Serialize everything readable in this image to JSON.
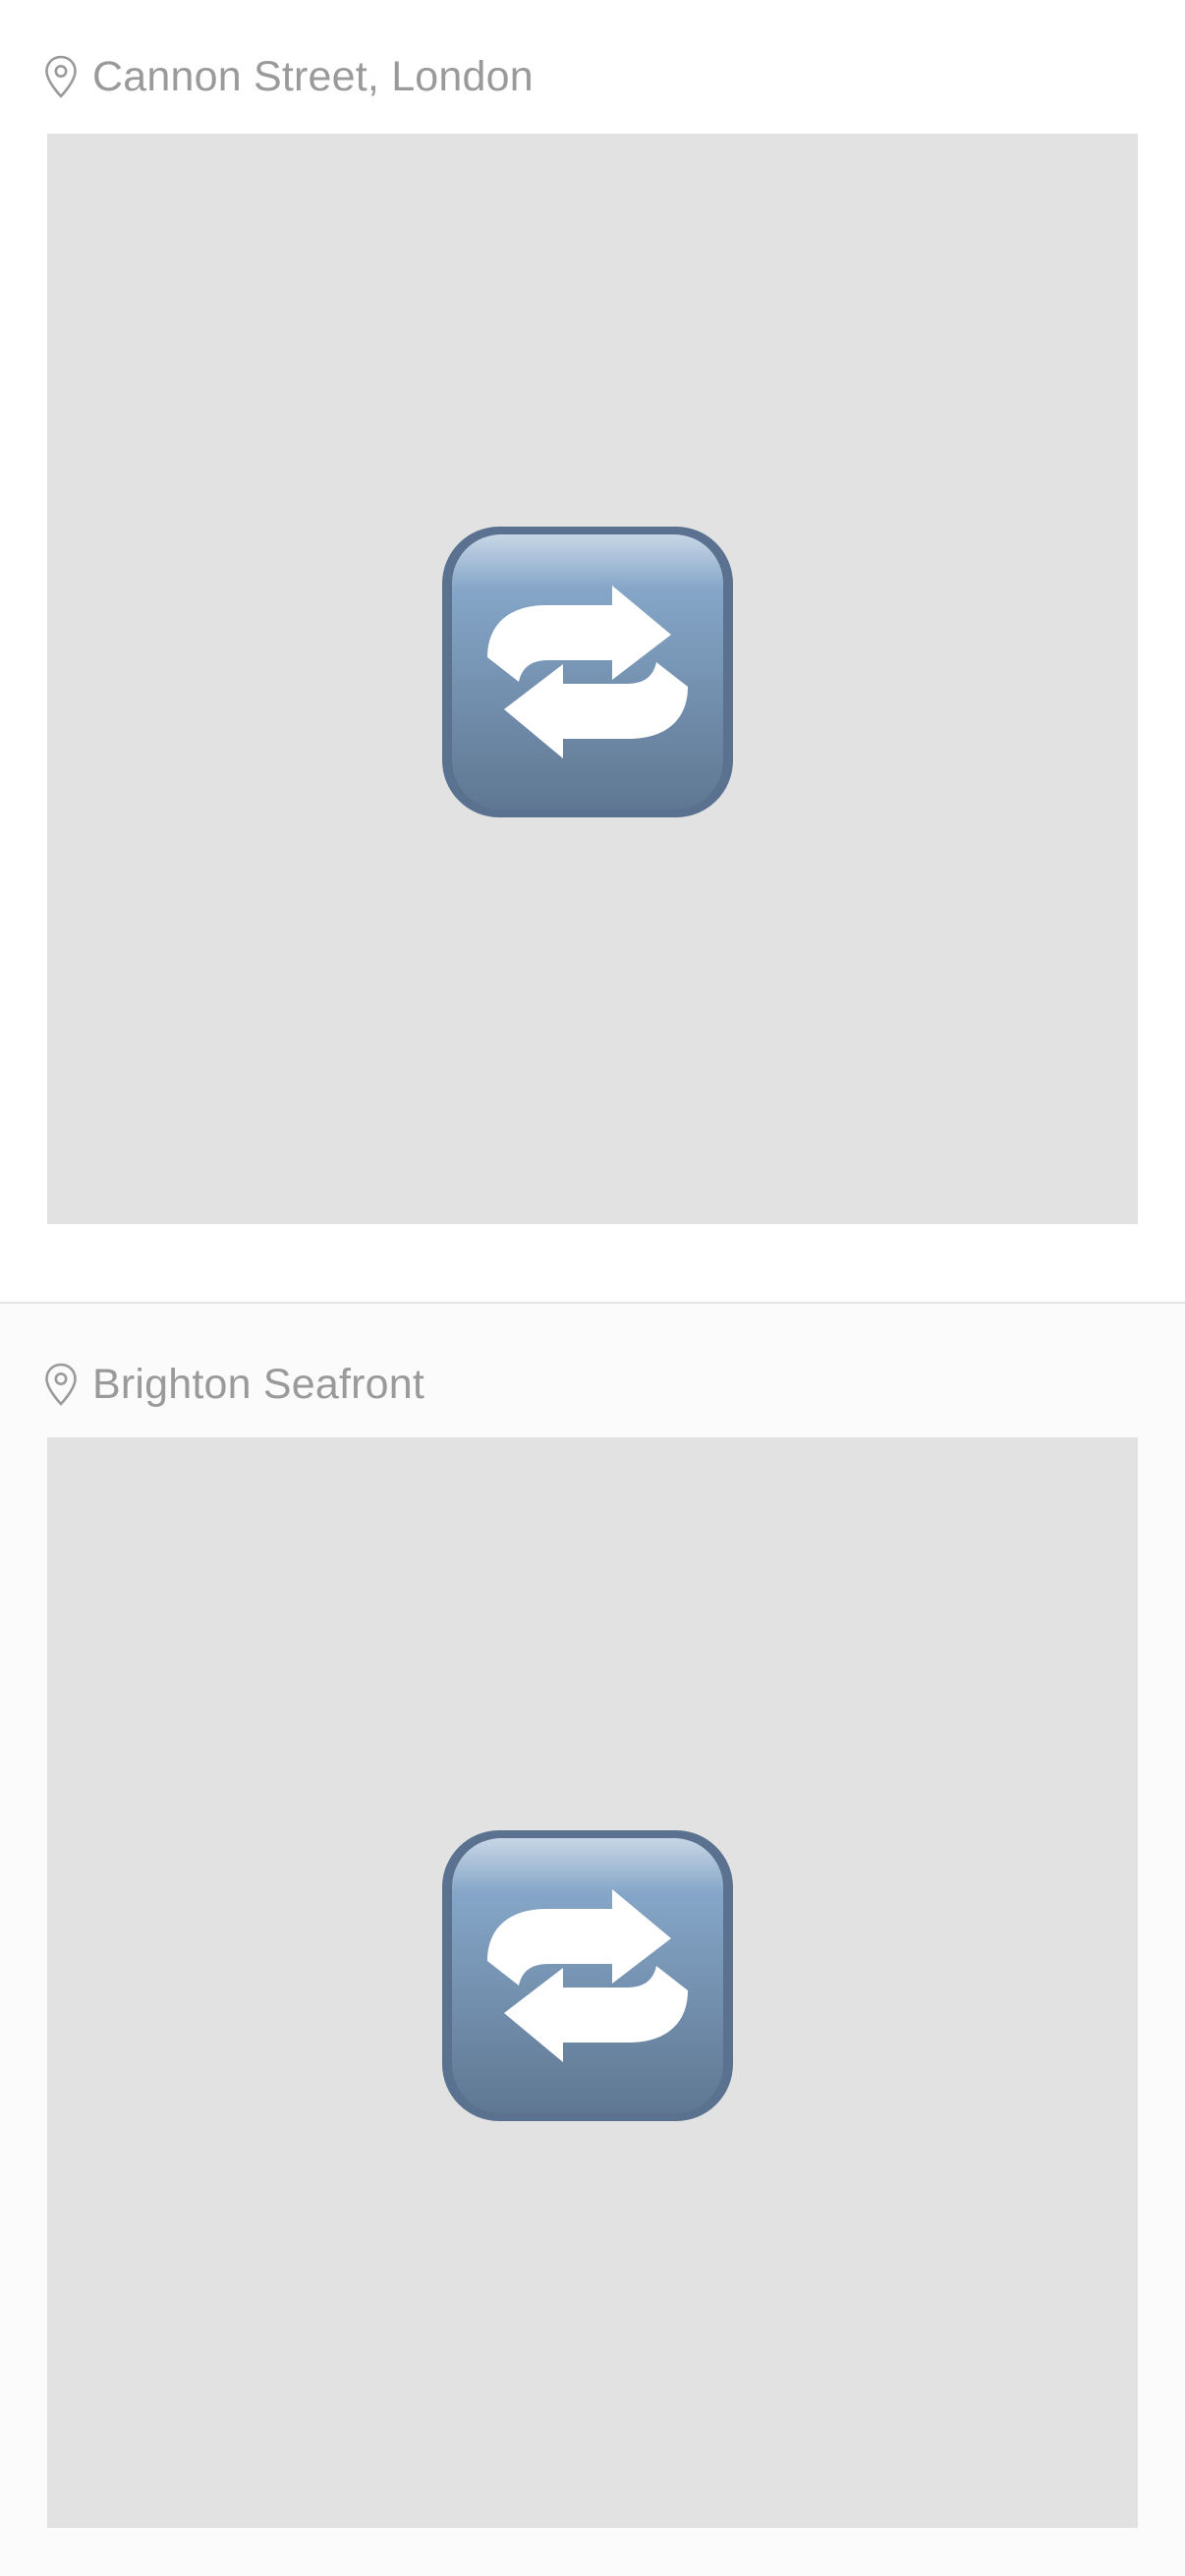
{
  "posts": [
    {
      "location": "Cannon Street, London",
      "location_icon": "location-pin-icon",
      "media_placeholder_icon": "repeat-button-icon"
    },
    {
      "location": "Brighton Seafront",
      "location_icon": "location-pin-icon",
      "media_placeholder_icon": "repeat-button-icon"
    }
  ],
  "colors": {
    "location_text": "#9a9a9a",
    "photo_background": "#e2e2e3",
    "divider": "#e4e4e4",
    "icon_blue_top": "#9fb9d6",
    "icon_blue_bottom": "#5f7792"
  }
}
